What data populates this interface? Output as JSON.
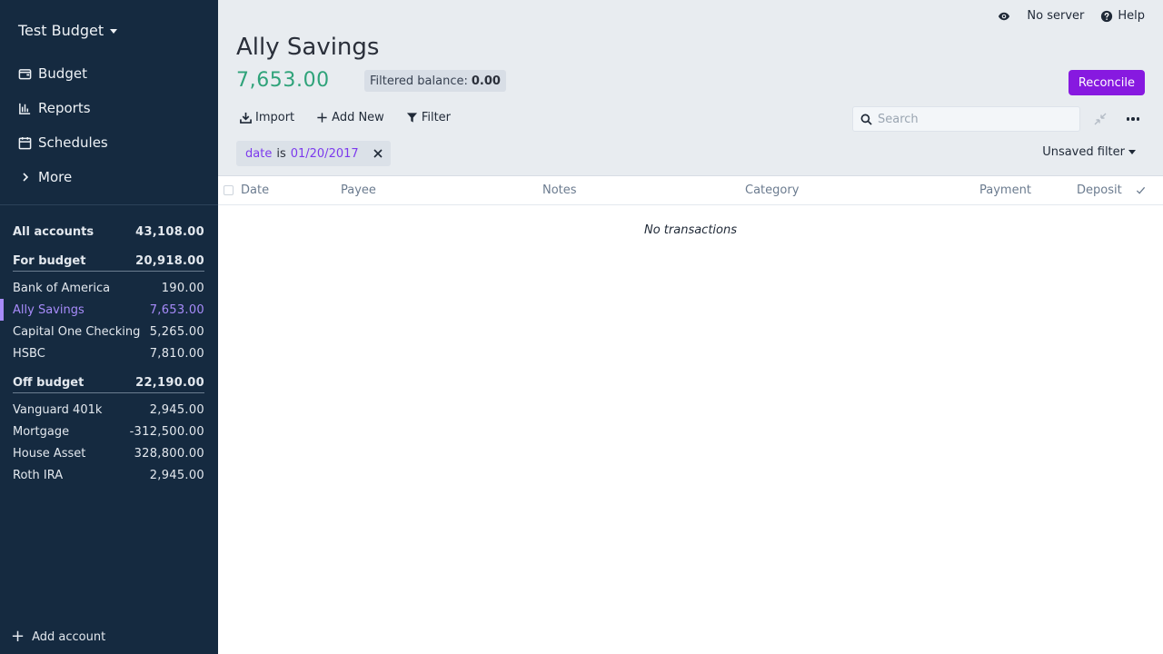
{
  "sidebar": {
    "budget_name": "Test Budget",
    "nav": [
      {
        "label": "Budget",
        "icon": "wallet-icon"
      },
      {
        "label": "Reports",
        "icon": "bar-chart-icon"
      },
      {
        "label": "Schedules",
        "icon": "calendar-icon"
      },
      {
        "label": "More",
        "icon": "chevron-right-icon"
      }
    ],
    "all_accounts": {
      "label": "All accounts",
      "amount": "43,108.00"
    },
    "for_budget": {
      "label": "For budget",
      "amount": "20,918.00"
    },
    "budget_accounts": [
      {
        "label": "Bank of America",
        "amount": "190.00"
      },
      {
        "label": "Ally Savings",
        "amount": "7,653.00"
      },
      {
        "label": "Capital One Checking",
        "amount": "5,265.00"
      },
      {
        "label": "HSBC",
        "amount": "7,810.00"
      }
    ],
    "off_budget": {
      "label": "Off budget",
      "amount": "22,190.00"
    },
    "off_accounts": [
      {
        "label": "Vanguard 401k",
        "amount": "2,945.00"
      },
      {
        "label": "Mortgage",
        "amount": "-312,500.00"
      },
      {
        "label": "House Asset",
        "amount": "328,800.00"
      },
      {
        "label": "Roth IRA",
        "amount": "2,945.00"
      }
    ],
    "add_account": "Add account"
  },
  "topbar": {
    "server": "No server",
    "help": "Help"
  },
  "account": {
    "title": "Ally Savings",
    "balance": "7,653.00",
    "filtered_label": "Filtered balance:",
    "filtered_value": "0.00",
    "reconcile": "Reconcile"
  },
  "toolbar": {
    "import": "Import",
    "add_new": "Add New",
    "filter": "Filter",
    "search_placeholder": "Search"
  },
  "filter_chip": {
    "field": "date",
    "op": "is",
    "value": "01/20/2017"
  },
  "unsaved_filter": "Unsaved filter",
  "table": {
    "columns": [
      "Date",
      "Payee",
      "Notes",
      "Category",
      "Payment",
      "Deposit"
    ],
    "empty": "No transactions"
  },
  "colors": {
    "sidebar_bg": "#152a40",
    "accent": "#8719e0",
    "selected_account": "#a78bfa",
    "balance_positive": "#2fa37a"
  }
}
